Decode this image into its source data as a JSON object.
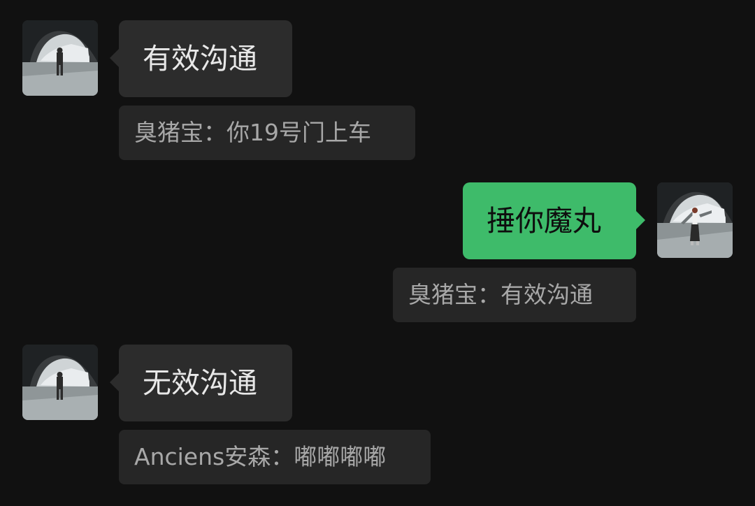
{
  "messages": [
    {
      "side": "received",
      "avatar_icon": "avatar-man-in-tunnel",
      "text": "有效沟通",
      "quote": "臭猪宝：你19号门上车"
    },
    {
      "side": "sent",
      "avatar_icon": "avatar-woman-in-tunnel",
      "text": "捶你魔丸",
      "quote": "臭猪宝：有效沟通"
    },
    {
      "side": "received",
      "avatar_icon": "avatar-man-in-tunnel",
      "text": "无效沟通",
      "quote": "Anciens安森：嘟嘟嘟嘟"
    }
  ],
  "colors": {
    "background": "#111111",
    "received_bubble": "#2c2c2c",
    "sent_bubble": "#3ebb6a",
    "quote_bg": "#262626",
    "quote_text": "#a8a8a8"
  }
}
